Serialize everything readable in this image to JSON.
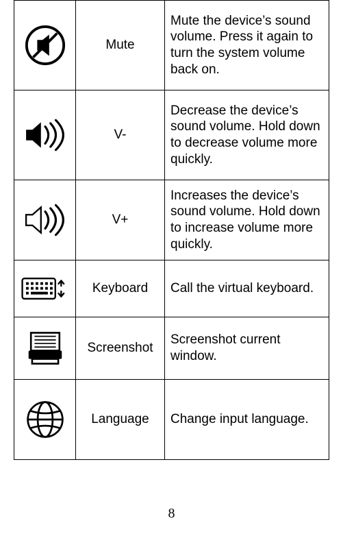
{
  "page_number": "8",
  "rows": [
    {
      "icon": "mute-icon",
      "label": "Mute",
      "description": "Mute the device’s sound volume. Press it again to turn the system volume back on."
    },
    {
      "icon": "volume-down-icon",
      "label": "V-",
      "description": "Decrease the device’s sound volume.  Hold down to decrease volume more quickly."
    },
    {
      "icon": "volume-up-icon",
      "label": "V+",
      "description": "Increases the device’s sound volume.  Hold down to increase volume more quickly."
    },
    {
      "icon": "keyboard-icon",
      "label": "Keyboard",
      "description": "Call the virtual keyboard."
    },
    {
      "icon": "screenshot-icon",
      "label": "Screenshot",
      "description": "Screenshot current window."
    },
    {
      "icon": "language-icon",
      "label": "Language",
      "description": "Change input language."
    }
  ]
}
